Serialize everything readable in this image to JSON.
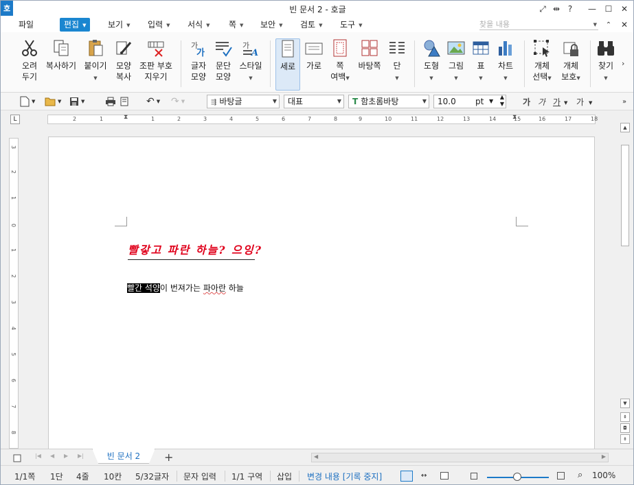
{
  "window": {
    "title": "빈 문서 2 - 호글",
    "logo": "호"
  },
  "menu": [
    {
      "label": "파일"
    },
    {
      "label": "편집",
      "active": true
    },
    {
      "label": "보기"
    },
    {
      "label": "입력"
    },
    {
      "label": "서식"
    },
    {
      "label": "쪽"
    },
    {
      "label": "보안"
    },
    {
      "label": "검토"
    },
    {
      "label": "도구"
    }
  ],
  "find": {
    "placeholder": "찾을 내용"
  },
  "ribbon": {
    "cut": [
      "오려",
      "두기"
    ],
    "copy": "복사하기",
    "paste": "붙이기",
    "shape_copy": [
      "모양",
      "복사"
    ],
    "erase_marks": [
      "조판 부호",
      "지우기"
    ],
    "char_shape": [
      "글자",
      "모양"
    ],
    "para_shape": [
      "문단",
      "모양"
    ],
    "style": "스타일",
    "vertical": "세로",
    "horizontal": "가로",
    "margin": [
      "쪽",
      "여백"
    ],
    "background": "바탕쪽",
    "column": "단",
    "shapes": "도형",
    "picture": "그림",
    "table": "표",
    "chart": "차트",
    "obj_select": [
      "개체",
      "선택"
    ],
    "obj_protect": [
      "개체",
      "보호"
    ],
    "find": "찾기"
  },
  "toolbar": {
    "style_combo": "바탕글",
    "lang_combo": "대표",
    "font_combo": "함초롬바탕",
    "size_value": "10.0",
    "size_unit": "pt",
    "fmt": [
      "가",
      "가",
      "가",
      "가"
    ]
  },
  "ruler": {
    "h": [
      "2",
      "1",
      "1",
      "2",
      "3",
      "4",
      "5",
      "6",
      "7",
      "8",
      "9",
      "10",
      "11",
      "12",
      "13",
      "14",
      "15",
      "16",
      "17",
      "18"
    ],
    "v": [
      "3",
      "2",
      "1",
      "0",
      "1",
      "2",
      "3",
      "4",
      "5",
      "6",
      "7",
      "8"
    ]
  },
  "document": {
    "title": "빨갛고 파란 하늘? 으잉?",
    "body_highlight": "빨간 석양",
    "body_part1": "이 번져가는 ",
    "body_squiggle": "파아란",
    "body_part2": " 하늘"
  },
  "tabs": {
    "doc_tab": "빈 문서 2",
    "add": "+"
  },
  "status": {
    "page": "1/1쪽",
    "column": "1단",
    "line": "4줄",
    "col": "10칸",
    "chars": "5/32글자",
    "mode": "문자 입력",
    "section": "1/1 구역",
    "insert": "삽입",
    "track": "변경 내용 [기록 중지]",
    "zoom": "100%"
  },
  "colors": {
    "accent": "#1a86d0",
    "title_red": "#e0001b",
    "track_blue": "#1c6fc0"
  }
}
